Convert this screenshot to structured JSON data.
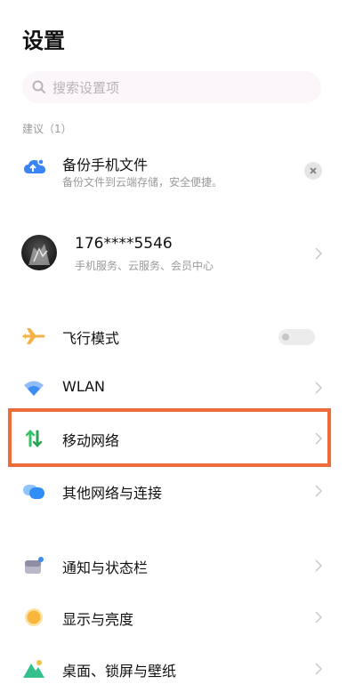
{
  "header": {
    "title": "设置"
  },
  "search": {
    "placeholder": "搜索设置项"
  },
  "suggestions": {
    "label": "建议（1）",
    "item": {
      "title": "备份手机文件",
      "subtitle": "备份文件到云端存储，安全便捷。"
    }
  },
  "account": {
    "phone": "176****5546",
    "subtitle": "手机服务、云服务、会员中心"
  },
  "settings": {
    "airplane": {
      "label": "飞行模式",
      "enabled": false
    },
    "wlan": {
      "label": "WLAN"
    },
    "mobile_network": {
      "label": "移动网络"
    },
    "other_network": {
      "label": "其他网络与连接"
    },
    "notifications": {
      "label": "通知与状态栏"
    },
    "display": {
      "label": "显示与亮度"
    },
    "wallpaper": {
      "label": "桌面、锁屏与壁纸"
    }
  },
  "colors": {
    "highlight": "#ee6b3a",
    "airplane_icon": "#f6b24a",
    "wlan_icon": "#3e8cf2",
    "mobile_icon_up": "#35c26a",
    "mobile_icon_down": "#2aa356",
    "cloud_icon": "#3a84f5",
    "display_icon": "#f8b73c",
    "wallpaper_icon": "#34c08a"
  }
}
